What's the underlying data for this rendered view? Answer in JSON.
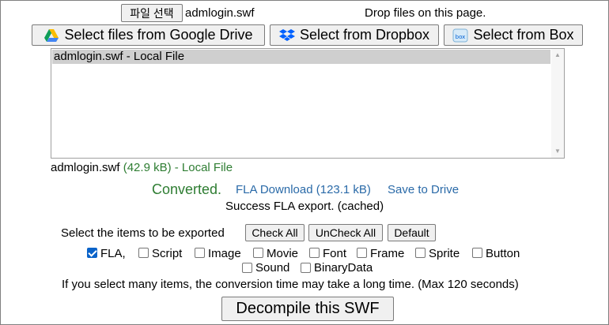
{
  "file_input": {
    "button_label": "파일 선택",
    "file_name": "admlogin.swf"
  },
  "drop_hint": "Drop files on this page.",
  "sources": {
    "google_drive": "Select files from Google Drive",
    "dropbox": "Select from Dropbox",
    "box": "Select from Box"
  },
  "file_list": {
    "items": [
      "admlogin.swf - Local File"
    ]
  },
  "file_info": {
    "name": "admlogin.swf",
    "size": "(42.9 kB) - Local File"
  },
  "result": {
    "status": "Converted.",
    "download_link": "FLA Download (123.1 kB)",
    "save_link": "Save to Drive",
    "message": "Success FLA export. (cached)"
  },
  "export": {
    "prompt": "Select the items to be exported",
    "check_all": "Check All",
    "uncheck_all": "UnCheck All",
    "default": "Default",
    "options": [
      {
        "label": "FLA,",
        "checked": true
      },
      {
        "label": "Script",
        "checked": false
      },
      {
        "label": "Image",
        "checked": false
      },
      {
        "label": "Movie",
        "checked": false
      },
      {
        "label": "Font",
        "checked": false
      },
      {
        "label": "Frame",
        "checked": false
      },
      {
        "label": "Sprite",
        "checked": false
      },
      {
        "label": "Button",
        "checked": false
      },
      {
        "label": "Sound",
        "checked": false
      },
      {
        "label": "BinaryData",
        "checked": false
      }
    ],
    "note": "If you select many items, the conversion time may take a long time. (Max 120 seconds)"
  },
  "decompile_button": "Decompile this SWF",
  "colors": {
    "status_green": "#2e7d32",
    "link_blue": "#2a6aa8",
    "checkbox_blue": "#0a63c9"
  }
}
